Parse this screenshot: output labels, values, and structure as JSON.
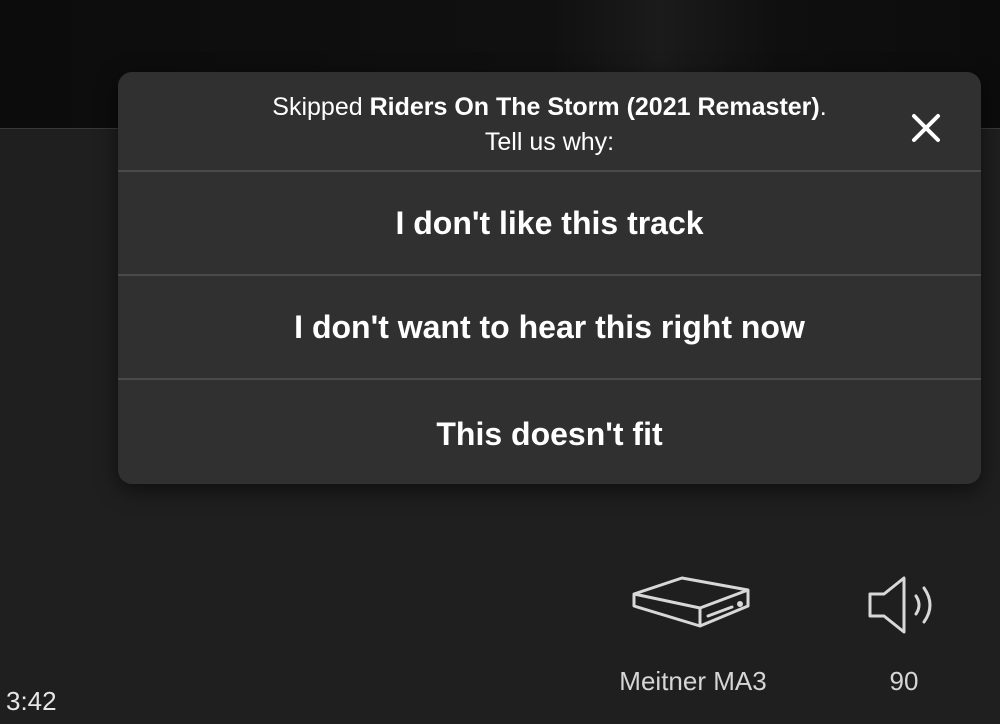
{
  "dialog": {
    "prefix": "Skipped ",
    "track": "Riders On The Storm (2021 Remaster)",
    "suffix": ".",
    "prompt": "Tell us why:",
    "options": [
      "I don't like this track",
      "I don't want to hear this right now",
      "This doesn't fit"
    ]
  },
  "player": {
    "device_label": "Meitner MA3",
    "volume": "90",
    "time": "3:42"
  },
  "icons": {
    "close": "close-icon",
    "device": "device-icon",
    "volume": "volume-icon"
  }
}
